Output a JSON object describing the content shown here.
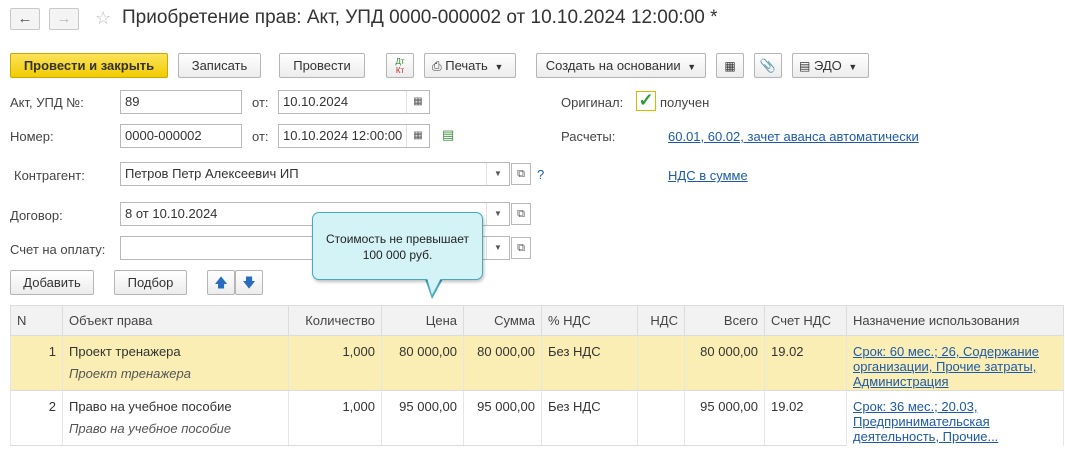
{
  "window": {
    "title": "Приобретение прав: Акт, УПД 0000-000002 от 10.10.2024 12:00:00 *"
  },
  "toolbar": {
    "post_and_close": "Провести и закрыть",
    "save": "Записать",
    "post": "Провести",
    "dt_kt": "Дт Кт",
    "print": "Печать",
    "create_based_on": "Создать на основании",
    "edo": "ЭДО"
  },
  "form": {
    "act_label": "Акт, УПД №:",
    "act_number": "89",
    "from_label": "от:",
    "act_date": "10.10.2024",
    "number_label": "Номер:",
    "number": "0000-000002",
    "number_date": "10.10.2024 12:00:00",
    "original_label": "Оригинал:",
    "original_received": "получен",
    "settlements_label": "Расчеты:",
    "settlements_link": "60.01, 60.02, зачет аванса автоматически",
    "counterparty_label": "Контрагент:",
    "counterparty": "Петров Петр Алексеевич ИП",
    "help": "?",
    "vat_link": "НДС в сумме",
    "contract_label": "Договор:",
    "contract": "8 от 10.10.2024",
    "invoice_label": "Счет на оплату:",
    "invoice": ""
  },
  "tooltip": {
    "line1": "Стоимость не превышает",
    "line2": "100 000 руб."
  },
  "table_toolbar": {
    "add": "Добавить",
    "select": "Подбор"
  },
  "table": {
    "columns": [
      "N",
      "Объект права",
      "Количество",
      "Цена",
      "Сумма",
      "% НДС",
      "НДС",
      "Всего",
      "Счет НДС",
      "Назначение использования"
    ],
    "rows": [
      {
        "n": "1",
        "object": "Проект тренажера",
        "object_sub": "Проект тренажера",
        "qty": "1,000",
        "price": "80 000,00",
        "sum": "80 000,00",
        "vat_rate": "Без НДС",
        "vat": "",
        "total": "80 000,00",
        "vat_account": "19.02",
        "purpose": "Срок: 60 мес.; 26, Содержание организации, Прочие затраты, Администрация"
      },
      {
        "n": "2",
        "object": "Право на учебное пособие",
        "object_sub": "Право на учебное пособие",
        "qty": "1,000",
        "price": "95 000,00",
        "sum": "95 000,00",
        "vat_rate": "Без НДС",
        "vat": "",
        "total": "95 000,00",
        "vat_account": "19.02",
        "purpose": "Срок: 36 мес.; 20.03, Предпринимательская деятельность, Прочие..."
      }
    ]
  },
  "colors": {
    "primary_button": "#f2cc00",
    "selected_row": "#fbeeb5",
    "link": "#1d5aa8",
    "tooltip_bg": "#d4f3f7"
  }
}
